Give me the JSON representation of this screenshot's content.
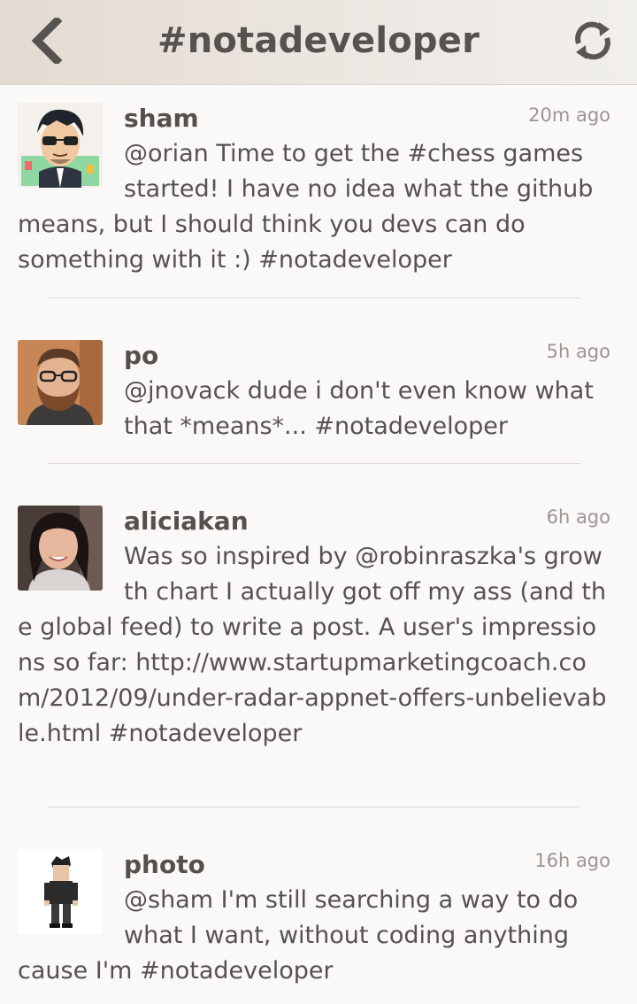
{
  "header": {
    "title": "#notadeveloper",
    "back_icon": "chevron-left-icon",
    "refresh_icon": "refresh-icon",
    "accent_color": "#555250"
  },
  "posts": [
    {
      "username": "sham",
      "time": "20m ago",
      "text": "@orian Time to get the #chess games started! I have no idea what the github means, but I should think you devs can do something with it :) #notadeveloper",
      "avatar": "cartoon-avatar-sunglasses"
    },
    {
      "username": "po",
      "time": "5h ago",
      "text": "@jnovack dude i don't even know what that *means*... #notadeveloper",
      "avatar": "photo-avatar-bearded-man"
    },
    {
      "username": "aliciakan",
      "time": "6h ago",
      "text": "Was so inspired by @robinraszka's growth chart I actually got off my ass (and the global feed) to write a post. A user's impressions so far: http://www.startupmarketingcoach.com/2012/09/under-radar-appnet-offers-unbelievable.html #notadeveloper",
      "avatar": "photo-avatar-woman"
    },
    {
      "username": "photo",
      "time": "16h ago",
      "text": "@sham I'm still searching a way to do what I want, without coding anything cause I'm #notadeveloper",
      "avatar": "pixel-avatar-character"
    }
  ]
}
